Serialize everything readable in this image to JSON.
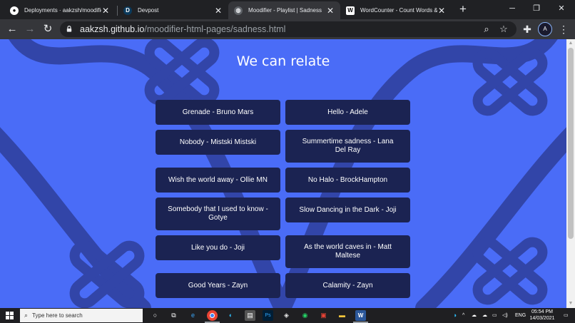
{
  "browser": {
    "tabs": [
      {
        "title": "Deployments · aakzsh/moodifier-html-pages",
        "icon": "github-icon",
        "active": false
      },
      {
        "title": "Devpost",
        "icon": "devpost-icon",
        "active": false
      },
      {
        "title": "Moodifier - Playlist | Sadness",
        "icon": "globe-icon",
        "active": true
      },
      {
        "title": "WordCounter - Count Words & Correct Writing",
        "icon": "wordcounter-icon",
        "active": false
      }
    ],
    "devpost_letter": "D",
    "wordcounter_letter": "W",
    "url_host": "aakzsh.github.io",
    "url_path": "/moodifier-html-pages/sadness.html",
    "profile_initials": "A"
  },
  "page": {
    "heading": "We can relate",
    "songs": [
      {
        "label": "Grenade - Bruno Mars"
      },
      {
        "label": "Hello - Adele"
      },
      {
        "label": "Nobody - Mistski Mistski"
      },
      {
        "label": "Summertime sadness - Lana Del Ray"
      },
      {
        "label": "Wish the world away - Ollie MN"
      },
      {
        "label": "No Halo - BrockHampton"
      },
      {
        "label": "Somebody that I used to know - Gotye"
      },
      {
        "label": "Slow Dancing in the Dark - Joji"
      },
      {
        "label": "Like you do - Joji"
      },
      {
        "label": "As the world caves in - Matt Maltese"
      },
      {
        "label": "Good Years - Zayn"
      },
      {
        "label": "Calamity - Zayn"
      }
    ],
    "colors": {
      "background": "#4a6cf7",
      "button": "#1b2352",
      "decoration": "#3245a8"
    }
  },
  "taskbar": {
    "search_placeholder": "Type here to search",
    "language": "ENG",
    "time": "05:54 PM",
    "date": "14/03/2021"
  }
}
